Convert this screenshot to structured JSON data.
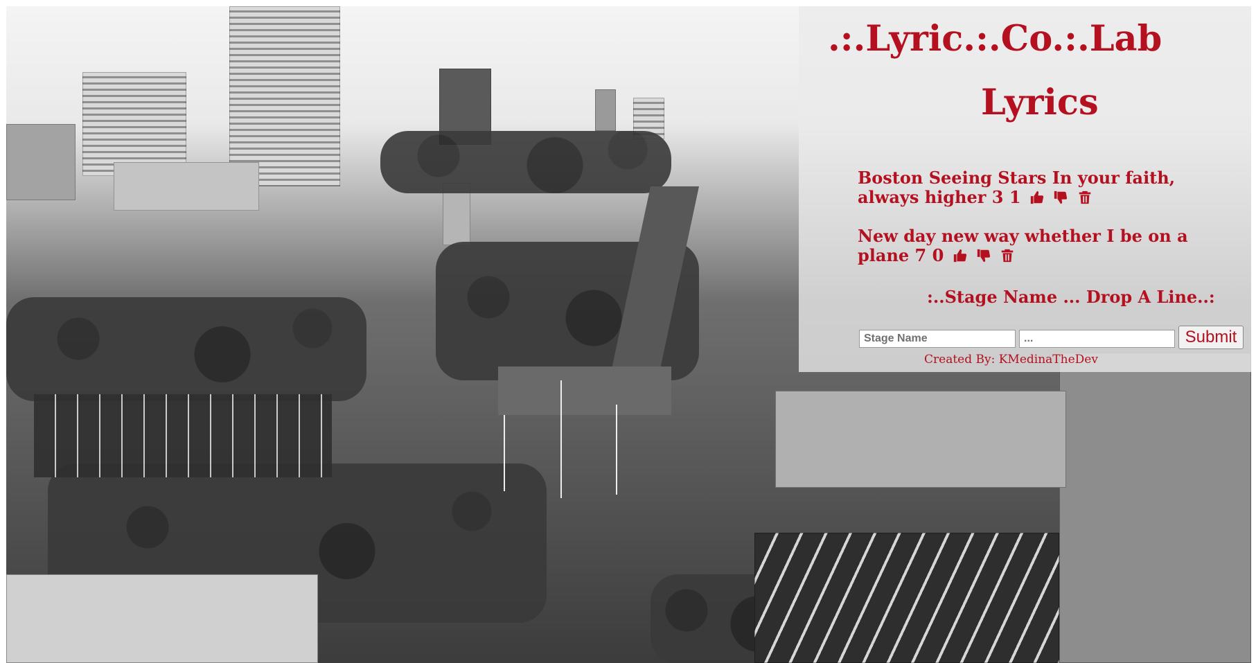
{
  "app": {
    "title": ".:.Lyric.:.Co.:.Lab"
  },
  "lyrics": {
    "heading": "Lyrics",
    "items": [
      {
        "text": "Boston Seeing Stars In your faith, always higher 3 1",
        "up_icon": "thumbs-up-icon",
        "down_icon": "thumbs-down-icon",
        "delete_icon": "trash-icon"
      },
      {
        "text": "New day new way whether I be on a plane 7 0",
        "up_icon": "thumbs-up-icon",
        "down_icon": "thumbs-down-icon",
        "delete_icon": "trash-icon"
      }
    ]
  },
  "form": {
    "heading": ":..Stage Name ... Drop A Line..:",
    "stage_name_placeholder": "Stage Name",
    "line_placeholder": "...",
    "submit_label": "Submit"
  },
  "footer": {
    "credit": "Created By: KMedinaTheDev"
  },
  "colors": {
    "accent": "#b4101f",
    "panel": "#ebebeb"
  }
}
